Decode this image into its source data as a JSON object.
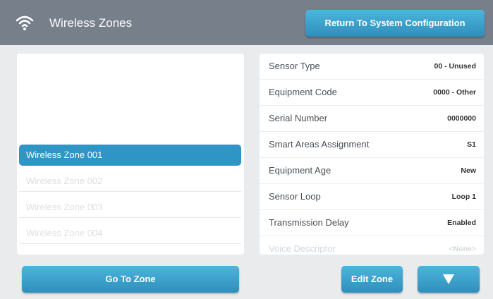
{
  "header": {
    "title": "Wireless Zones",
    "return_button": "Return To System Configuration",
    "icon": "wifi-icon"
  },
  "zones": [
    {
      "label": "Wireless Zone 001",
      "selected": true
    },
    {
      "label": "Wireless Zone 002",
      "selected": false
    },
    {
      "label": "Wireless Zone 003",
      "selected": false
    },
    {
      "label": "Wireless Zone 004",
      "selected": false
    }
  ],
  "details": [
    {
      "label": "Sensor Type",
      "value": "00 - Unused"
    },
    {
      "label": "Equipment Code",
      "value": "0000 - Other"
    },
    {
      "label": "Serial Number",
      "value": "0000000"
    },
    {
      "label": "Smart Areas Assignment",
      "value": "S1"
    },
    {
      "label": "Equipment Age",
      "value": "New"
    },
    {
      "label": "Sensor Loop",
      "value": "Loop 1"
    },
    {
      "label": "Transmission Delay",
      "value": "Enabled"
    },
    {
      "label": "Voice Descriptor",
      "value": "<None>"
    }
  ],
  "footer": {
    "go_to_zone": "Go To Zone",
    "edit_zone": "Edit Zone",
    "scroll_down_icon": "down-arrow-icon"
  },
  "colors": {
    "header_bg": "#767f8a",
    "accent": "#2e95c4",
    "page_bg": "#e9ebed"
  }
}
